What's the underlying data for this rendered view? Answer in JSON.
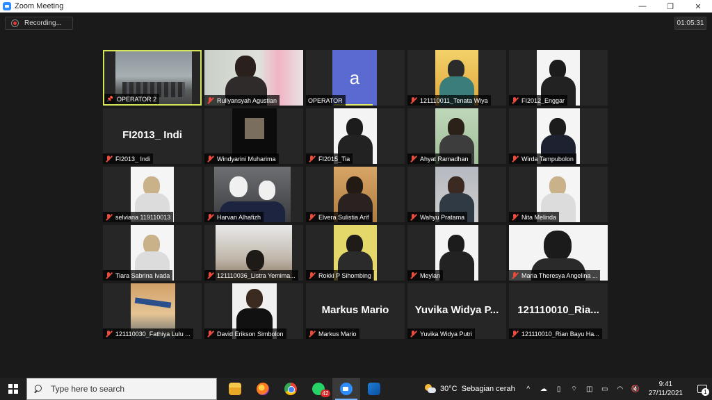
{
  "window": {
    "title": "Zoom Meeting",
    "minimize": "—",
    "restore": "❐",
    "close": "✕"
  },
  "meeting": {
    "recording_label": "Recording...",
    "timer": "01:05:31",
    "tiles": [
      {
        "name": "OPERATOR 2",
        "muted": false,
        "pinned": true,
        "video": "warehouse"
      },
      {
        "name": "Rullyansyah Agustian",
        "muted": true,
        "video": "boy"
      },
      {
        "name": "OPERATOR",
        "muted": false,
        "avatar_letter": "a",
        "video": "avatar"
      },
      {
        "name": "121110011_Tenata Wiya",
        "muted": true,
        "video": "portrait-red"
      },
      {
        "name": "FI2012_Enggar",
        "muted": true,
        "video": "portrait"
      },
      {
        "name": "FI2013_ Indi",
        "muted": true,
        "display_text": "FI2013_ Indi",
        "video": "none"
      },
      {
        "name": "Windyarini Muharima",
        "muted": true,
        "video": "dark"
      },
      {
        "name": "FI2015_Tia",
        "muted": true,
        "video": "portrait"
      },
      {
        "name": "Ahyat Ramadhan",
        "muted": true,
        "video": "portrait-green"
      },
      {
        "name": "Wirda Tampubolon",
        "muted": true,
        "video": "portrait-white2"
      },
      {
        "name": "selviana 119110013",
        "muted": true,
        "video": "portrait-hijab"
      },
      {
        "name": "Harvan Alhafizh",
        "muted": true,
        "video": "duo"
      },
      {
        "name": "Elvera Sulistia Arif",
        "muted": true,
        "video": "portrait-warm"
      },
      {
        "name": "Wahyu  Pratama",
        "muted": true,
        "video": "portrait-room"
      },
      {
        "name": "Nita Melinda",
        "muted": true,
        "video": "portrait-hijab"
      },
      {
        "name": "Tiara Sabrina Ivada",
        "muted": true,
        "video": "portrait-hijab"
      },
      {
        "name": "121110036_Listra Yemima...",
        "muted": true,
        "video": "ceiling"
      },
      {
        "name": "Rokki P Sihombing",
        "muted": true,
        "video": "portrait-yellow"
      },
      {
        "name": "Meylan",
        "muted": true,
        "video": "portrait"
      },
      {
        "name": "Maria Theresya Angelina ...",
        "muted": true,
        "video": "wide"
      },
      {
        "name": "121110030_Fathiya Lulu ...",
        "muted": true,
        "video": "plane"
      },
      {
        "name": "David Erikson Simbolon",
        "muted": true,
        "video": "suit"
      },
      {
        "name": "Markus Mario",
        "muted": true,
        "display_text": "Markus Mario",
        "video": "none"
      },
      {
        "name": "Yuvika Widya Putri",
        "muted": true,
        "display_text": "Yuvika  Widya  P...",
        "video": "none"
      },
      {
        "name": "121110010_Rian Bayu Ha...",
        "muted": true,
        "display_text": "121110010_Ria...",
        "video": "none"
      }
    ]
  },
  "taskbar": {
    "search_placeholder": "Type here to search",
    "apps": [
      {
        "name": "file-explorer",
        "icon": "folder-icon"
      },
      {
        "name": "firefox",
        "icon": "firefox-icon"
      },
      {
        "name": "chrome",
        "icon": "chrome-icon"
      },
      {
        "name": "whatsapp",
        "icon": "whatsapp-icon",
        "badge": "42"
      },
      {
        "name": "zoom",
        "icon": "zoom-icon",
        "active": true
      },
      {
        "name": "media",
        "icon": "media-icon"
      }
    ],
    "weather_temp": "30°C",
    "weather_desc": "Sebagian cerah",
    "tray_expand": "^",
    "clock_time": "9:41",
    "clock_date": "27/11/2021",
    "notification_count": "1"
  }
}
